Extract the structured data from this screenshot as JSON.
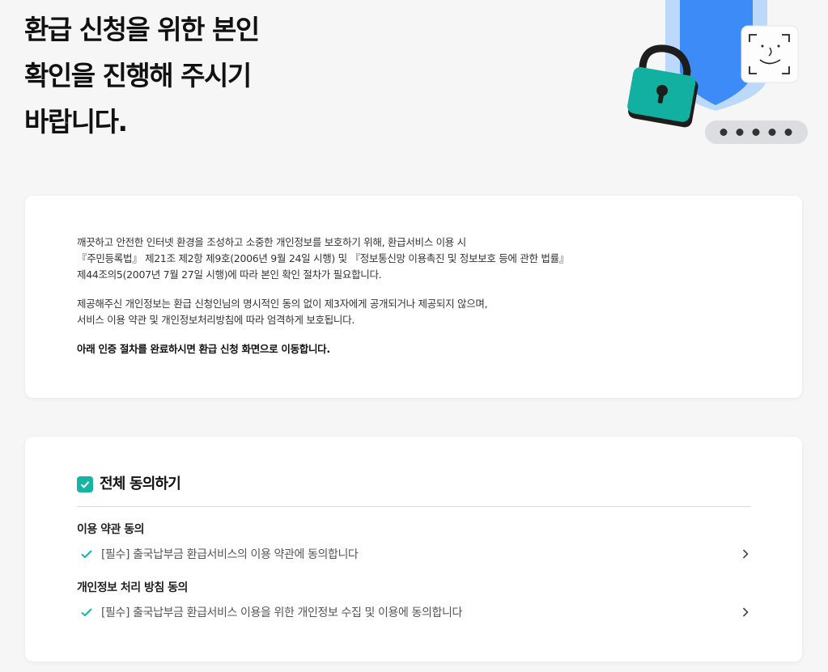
{
  "hero": {
    "title_lines": [
      "환급 신청을 위한 본인",
      "확인을 진행해 주시기",
      "바랍니다."
    ],
    "illustration": {
      "icons": [
        "shield-icon",
        "padlock-icon",
        "face-scan-icon",
        "password-dots-icon"
      ]
    }
  },
  "notice": {
    "para1": [
      "깨끗하고 안전한 인터넷 환경을 조성하고 소중한 개인정보를 보호하기 위해, 환급서비스 이용 시",
      "『주민등록법』 제21조 제2항 제9호(2006년 9월 24일 시행) 및 『정보통신망 이용촉진 및 정보보호 등에 관한 법률』",
      "제44조의5(2007년 7월 27일 시행)에 따라 본인 확인 절차가 필요합니다."
    ],
    "para2": [
      "제공해주신 개인정보는 환급 신청인님의 명시적인 동의 없이 제3자에게 공개되거나 제공되지 않으며,",
      "서비스 이용 약관 및 개인정보처리방침에 따라 엄격하게 보호됩니다."
    ],
    "para3": "아래 인증 절차를 완료하시면 환급 신청 화면으로 이동합니다."
  },
  "agreement": {
    "all_label": "전체 동의하기",
    "all_checked": true,
    "sections": [
      {
        "title": "이용 약관 동의",
        "item": "[필수] 출국납부금 환급서비스의 이용 약관에 동의합니다",
        "checked": true
      },
      {
        "title": "개인정보 처리 방침 동의",
        "item": "[필수] 출국납부금 환급서비스 이용을 위한 개인정보 수집 및 이용에 동의합니다",
        "checked": true
      }
    ]
  },
  "colors": {
    "accent": "#17b3a3",
    "shield": "#3d8bf7",
    "lock": "#0fb1a2"
  }
}
